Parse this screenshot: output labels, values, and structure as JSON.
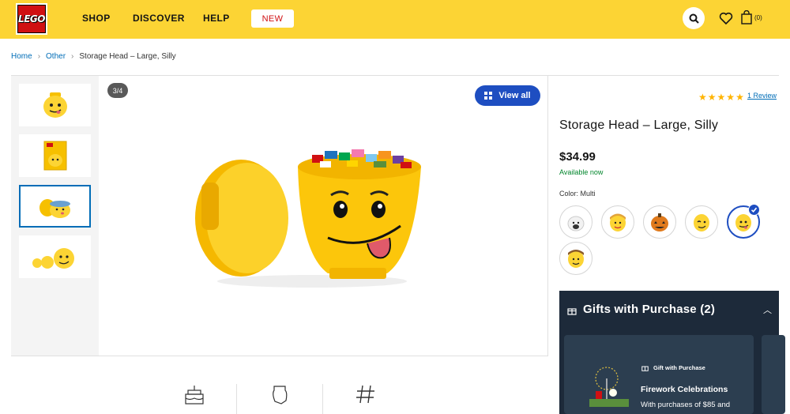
{
  "header": {
    "logo_text": "LEGO",
    "nav": [
      "SHOP",
      "DISCOVER",
      "HELP"
    ],
    "new_label": "NEW",
    "bag_count": "(0)",
    "colors": {
      "bar": "#fcd434",
      "logo": "#d01012",
      "new_text": "#d01012"
    }
  },
  "breadcrumb": {
    "items": [
      "Home",
      "Other"
    ],
    "current": "Storage Head – Large, Silly"
  },
  "gallery": {
    "counter": "3/4",
    "view_all": "View all",
    "active_index": 2,
    "thumb_count": 4
  },
  "product": {
    "rating": 5,
    "review_link": "1 Review",
    "title": "Storage Head – Large, Silly",
    "price": "$34.99",
    "availability": "Available now",
    "color_label": "Color: Multi",
    "swatches": [
      "white-sheep",
      "blonde-girl",
      "pumpkin",
      "winking",
      "silly",
      "boy"
    ],
    "selected_swatch": "silly",
    "accent": "#1e4ec1"
  },
  "gifts": {
    "title": "Gifts with Purchase (2)",
    "card": {
      "label": "Gift with Purchase",
      "title": "Firework Celebrations",
      "description": "With purchases of $85 and"
    }
  }
}
